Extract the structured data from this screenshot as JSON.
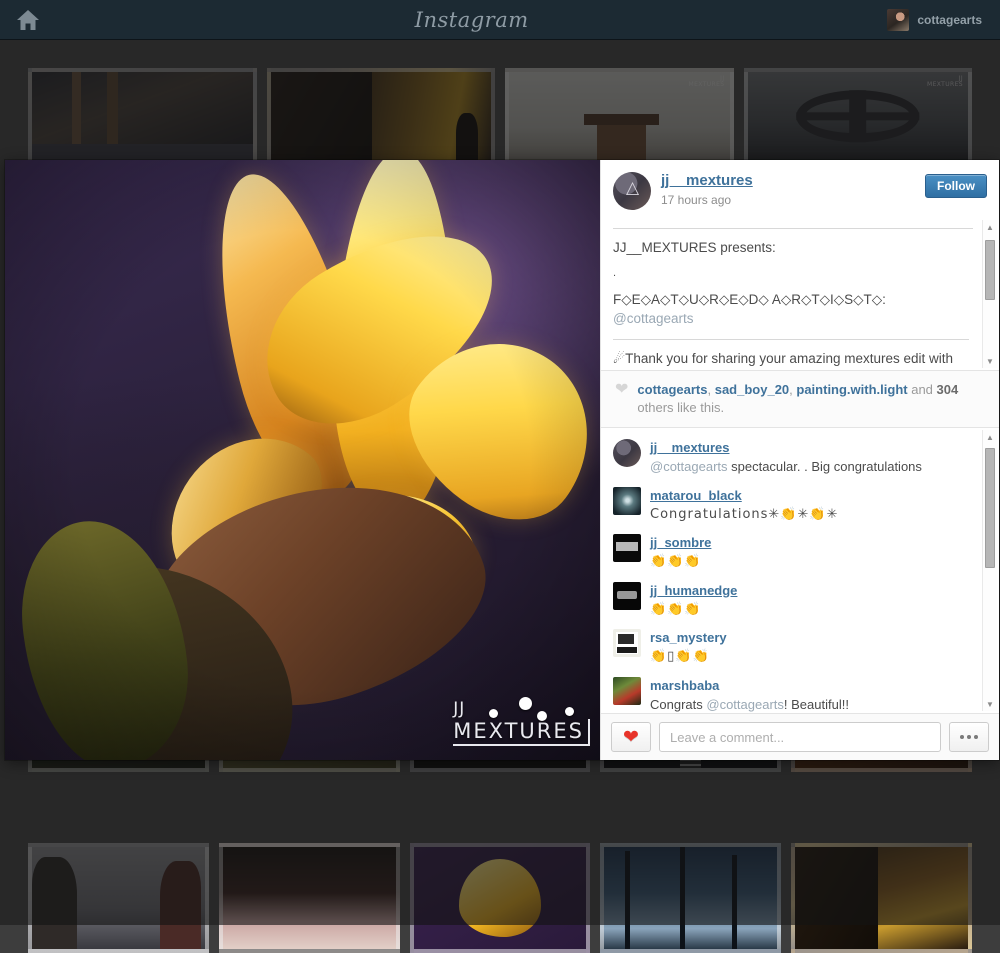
{
  "nav": {
    "home_icon": "home-icon",
    "brand": "Instagram",
    "username": "cottagearts"
  },
  "post": {
    "username": "jj__mextures",
    "timestamp": "17 hours ago",
    "follow_label": "Follow",
    "caption": {
      "line1": "JJ__MEXTURES presents:",
      "line2": ".",
      "line3": "F◇E◇A◇T◇U◇R◇E◇D◇ A◇R◇T◇I◇S◇T◇:",
      "mention": "@cottagearts",
      "line4": "☄Thank you for sharing your amazing mextures edit with us."
    },
    "watermark": {
      "top": "JJ",
      "bottom": "MEXTURES"
    }
  },
  "likes": {
    "names": [
      "cottagearts",
      "sad_boy_20",
      "painting.with.light"
    ],
    "and": "and",
    "count": "304",
    "suffix": "others like this."
  },
  "comments": [
    {
      "username": "jj__mextures",
      "mention": "@cottagearts",
      "text": " spectacular. . Big congratulations",
      "avatar": "round"
    },
    {
      "username": "matarou_black",
      "mention": "",
      "text": "Congratulations✳👏✳👏✳",
      "avatar": "square"
    },
    {
      "username": "jj_sombre",
      "mention": "",
      "text": "👏👏👏",
      "avatar": "square"
    },
    {
      "username": "jj_humanedge",
      "mention": "",
      "text": "👏👏👏",
      "avatar": "square"
    },
    {
      "username": "rsa_mystery",
      "mention": "",
      "text": "👏▯👏👏",
      "avatar": "square"
    },
    {
      "username": "marshbaba",
      "mention": "@cottagearts",
      "text_before": "Congrats ",
      "text": "! Beautiful!!",
      "avatar": "square"
    }
  ],
  "composer": {
    "like_icon": "heart-icon",
    "placeholder": "Leave a comment...",
    "more_icon": "ellipsis-icon"
  },
  "scrollbars": {
    "up_arrow": "▲",
    "down_arrow": "▼"
  },
  "colors": {
    "nav_bg": "#1c2a33",
    "link_blue": "#3f729b",
    "follow_blue": "#2f6fa3",
    "heart_red": "#e8342a",
    "muted_gray": "#9a9a9a"
  },
  "background_grid": {
    "thumb_watermark_top": "JJ",
    "thumb_watermark_bottom": "MEXTURES"
  }
}
